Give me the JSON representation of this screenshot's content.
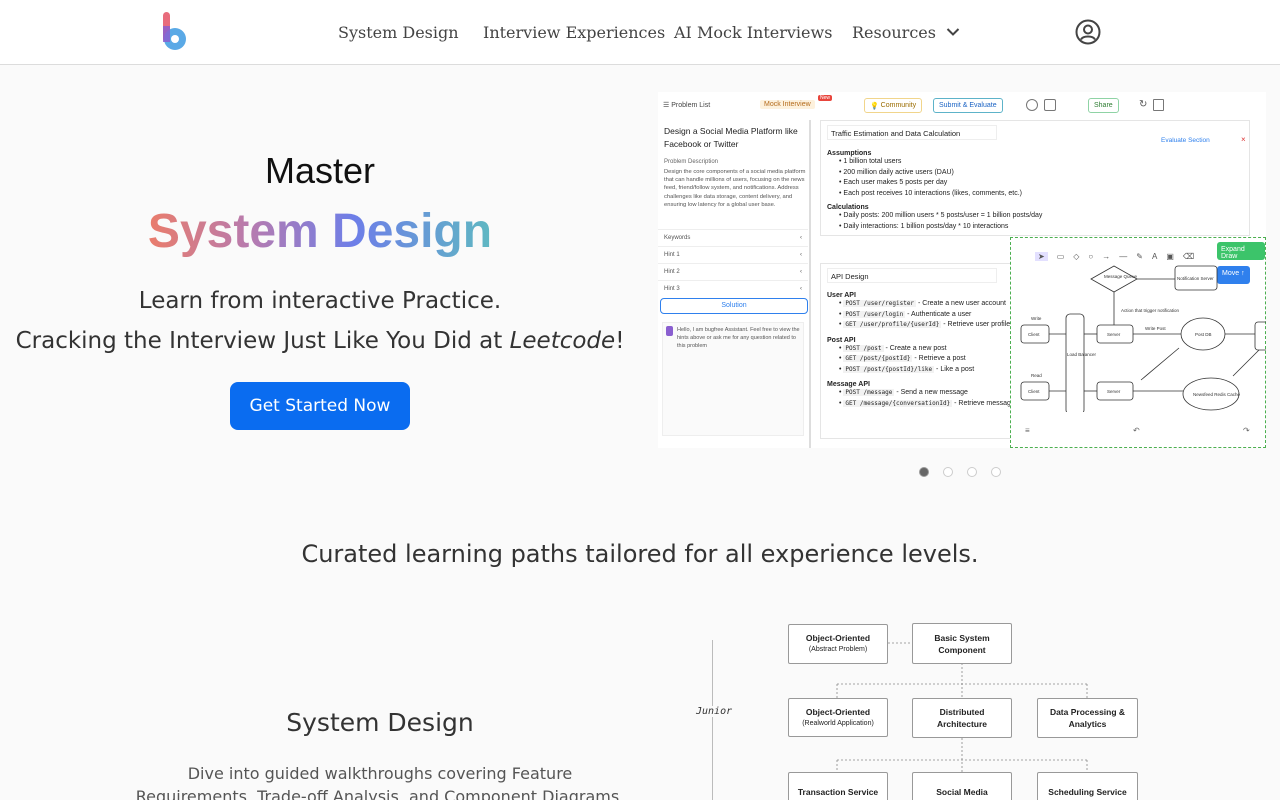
{
  "nav": {
    "items": [
      "System Design",
      "Interview Experiences",
      "AI Mock Interviews",
      "Resources"
    ]
  },
  "hero": {
    "master": "Master",
    "title": "System Design",
    "line1": "Learn from interactive Practice.",
    "line2_prefix": "Cracking the Interview Just Like You Did at ",
    "line2_em": "Leetcode",
    "line2_suffix": "!",
    "cta": "Get Started Now"
  },
  "preview": {
    "problem_list": "Problem List",
    "mock_interview": "Mock Interview",
    "new_badge": "New",
    "community": "Community",
    "submit": "Submit & Evaluate",
    "share": "Share",
    "problem_title": "Design a Social Media Platform like Facebook or Twitter",
    "problem_desc_label": "Problem Description",
    "problem_desc": "Design the core components of a social media platform that can handle millions of users, focusing on the news feed, friend/follow system, and notifications. Address challenges like data storage, content delivery, and ensuring low latency for a global user base.",
    "rows": [
      "Keywords",
      "Hint 1",
      "Hint 2",
      "Hint 3"
    ],
    "solution": "Solution",
    "assistant": "Hello, I am bugfree Assistant. Feel free to view the hints above or ask me for any question related to this problem",
    "section1_title": "Traffic Estimation and Data Calculation",
    "evaluate_section": "Evaluate Section",
    "assumptions": "Assumptions",
    "assumption_items": [
      "1 billion total users",
      "200 million daily active users (DAU)",
      "Each user makes 5 posts per day",
      "Each post receives 10 interactions (likes, comments, etc.)"
    ],
    "calculations": "Calculations",
    "calc_items": [
      "Daily posts: 200 million users * 5 posts/user = 1 billion posts/day",
      "Daily interactions: 1 billion posts/day * 10 interactions"
    ],
    "section2_title": "API Design",
    "user_api": "User API",
    "user_api_items": [
      {
        "code": "POST /user/register",
        "desc": " - Create a new user account"
      },
      {
        "code": "POST /user/login",
        "desc": " - Authenticate a user"
      },
      {
        "code": "GET /user/profile/{userId}",
        "desc": " - Retrieve user profile"
      }
    ],
    "post_api": "Post API",
    "post_api_items": [
      {
        "code": "POST /post",
        "desc": " - Create a new post"
      },
      {
        "code": "GET /post/{postId}",
        "desc": " - Retrieve a post"
      },
      {
        "code": "POST /post/{postId}/like",
        "desc": " - Like a post"
      }
    ],
    "message_api": "Message API",
    "message_api_items": [
      {
        "code": "POST /message",
        "desc": " - Send a new message"
      },
      {
        "code": "GET /message/{conversationId}",
        "desc": " - Retrieve messages"
      }
    ],
    "expand_draw": "Expand Draw",
    "move": "Move",
    "diagram_labels": [
      "Write",
      "Client",
      "Read",
      "Client",
      "Server",
      "Server",
      "Load Balancer",
      "Message Queue",
      "Notification Server",
      "Action that trigger notification",
      "Write Post",
      "Post DB",
      "Newsfeed Redis Cache"
    ]
  },
  "carousel": {
    "count": 4,
    "active": 0
  },
  "section2": {
    "headline": "Curated learning paths tailored for all experience levels.",
    "title": "System Design",
    "desc": "Dive into guided walkthroughs covering Feature Requirements, Trade-off Analysis, and Component Diagrams."
  },
  "learning_path": {
    "level_label": "Junior",
    "nodes": [
      {
        "title": "Object-Oriented",
        "sub": "(Abstract Problem)"
      },
      {
        "title": "Basic System Component",
        "sub": ""
      },
      {
        "title": "Object-Oriented",
        "sub": "(Realworld Application)"
      },
      {
        "title": "Distributed Architecture",
        "sub": ""
      },
      {
        "title": "Data Processing & Analytics",
        "sub": ""
      },
      {
        "title": "Transaction Service",
        "sub": ""
      },
      {
        "title": "Social Media",
        "sub": ""
      },
      {
        "title": "Scheduling Service",
        "sub": ""
      }
    ]
  },
  "colors": {
    "primary": "#0a6cf0",
    "gradient": [
      "#ea7c6b",
      "#b67bb0",
      "#6d7ee8",
      "#5fb8c2"
    ],
    "green": "#4caf50"
  },
  "icons": {
    "logo": "bugfree-logo",
    "chevron": "chevron-down-icon",
    "user": "user-circle-icon"
  }
}
